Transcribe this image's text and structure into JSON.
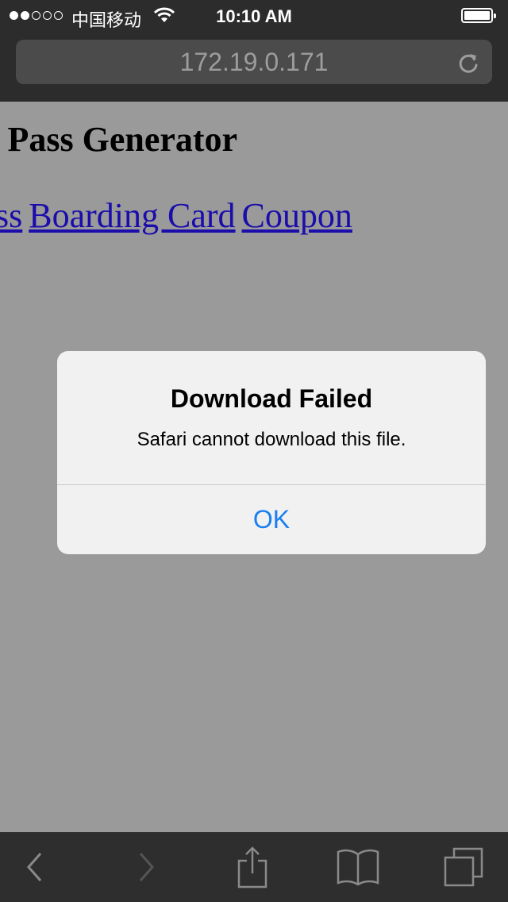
{
  "status_bar": {
    "carrier": "中国移动",
    "time": "10:10 AM",
    "signal_bars_filled": 2,
    "signal_bars_total": 5
  },
  "browser": {
    "url": "172.19.0.171"
  },
  "page": {
    "title": "k Pass Generator",
    "links": [
      "ss",
      "Boarding Card",
      "Coupon"
    ]
  },
  "alert": {
    "title": "Download Failed",
    "message": "Safari cannot download this file.",
    "ok_label": "OK"
  },
  "toolbar": {
    "icons": [
      "back-icon",
      "forward-icon",
      "share-icon",
      "bookmarks-icon",
      "tabs-icon"
    ]
  },
  "colors": {
    "link": "#1a0dab",
    "alert_button": "#1a7ff0",
    "overlay_background": "#9a9a9a"
  }
}
